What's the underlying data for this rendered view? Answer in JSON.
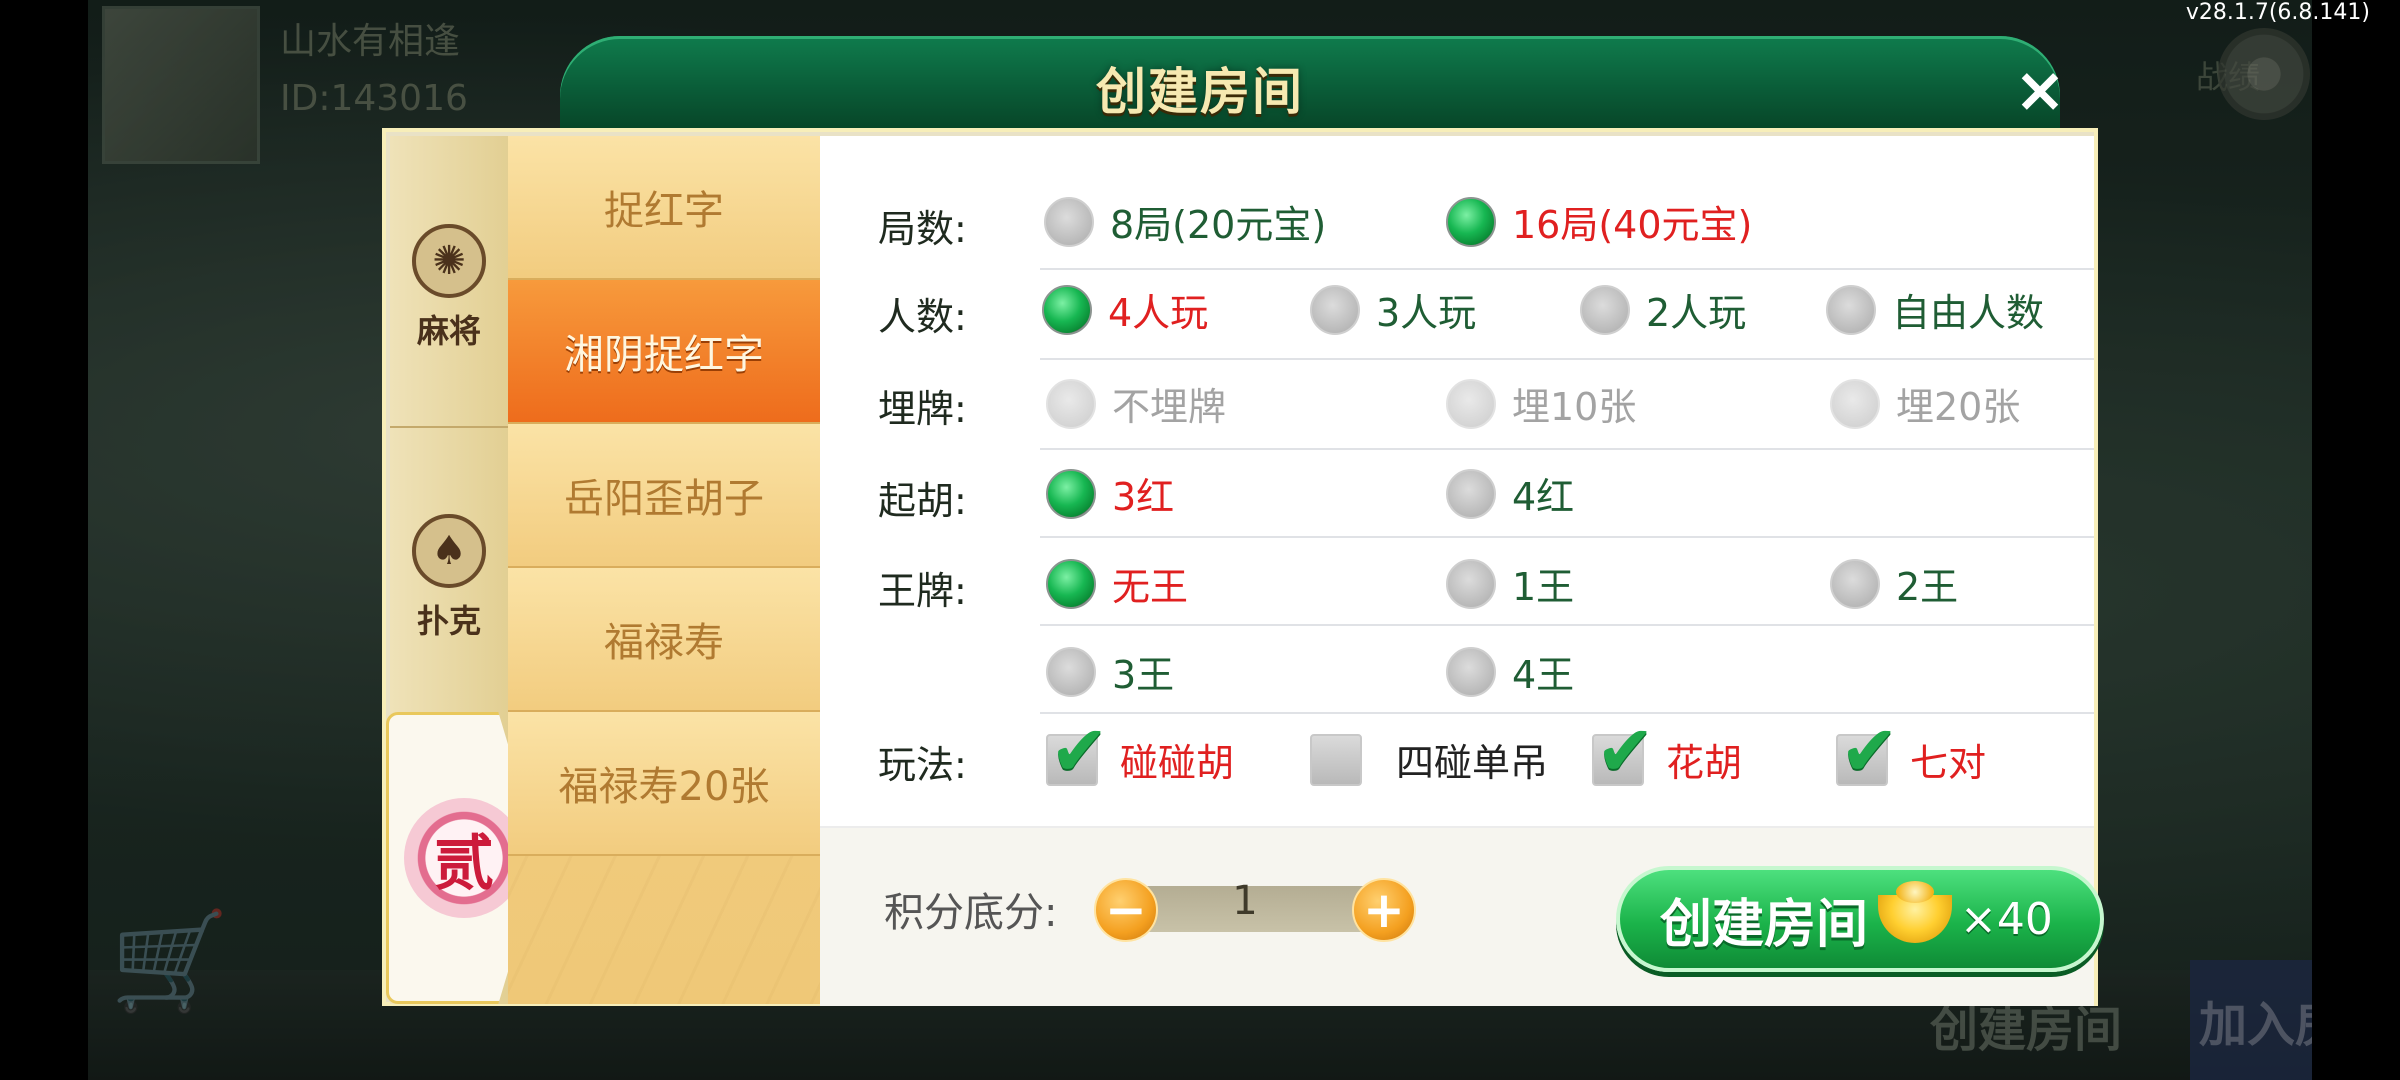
{
  "version": "v28.1.7(6.8.141)",
  "background": {
    "player_name": "山水有相逢",
    "player_id": "ID:143016",
    "record_label": "战绩",
    "bottom_create": "创建房间",
    "bottom_join": "加入房间"
  },
  "dialog": {
    "title": "创建房间",
    "close_label": "×"
  },
  "sidebar": {
    "categories": [
      {
        "label": "麻将",
        "icon": "mahjong-icon"
      },
      {
        "label": "扑克",
        "icon": "spade-icon"
      },
      {
        "label": "贰",
        "icon": "er-badge-icon"
      }
    ]
  },
  "games": [
    {
      "label": "捉红字",
      "active": false
    },
    {
      "label": "湘阴捉红字",
      "active": true
    },
    {
      "label": "岳阳歪胡子",
      "active": false
    },
    {
      "label": "福禄寿",
      "active": false
    },
    {
      "label": "福禄寿20张",
      "active": false
    }
  ],
  "options": {
    "rounds": {
      "label": "局数:",
      "choices": [
        "8局(20元宝)",
        "16局(40元宝)"
      ],
      "selected": 1
    },
    "players": {
      "label": "人数:",
      "choices": [
        "4人玩",
        "3人玩",
        "2人玩",
        "自由人数"
      ],
      "selected": 0
    },
    "bury": {
      "label": "埋牌:",
      "choices": [
        "不埋牌",
        "埋10张",
        "埋20张"
      ],
      "disabled": true
    },
    "qihu": {
      "label": "起胡:",
      "choices": [
        "3红",
        "4红"
      ],
      "selected": 0
    },
    "king": {
      "label": "王牌:",
      "choices": [
        "无王",
        "1王",
        "2王",
        "3王",
        "4王"
      ],
      "selected": 0
    },
    "play": {
      "label": "玩法:",
      "choices": [
        "碰碰胡",
        "四碰单吊",
        "花胡",
        "七对"
      ],
      "checked": [
        true,
        false,
        true,
        true
      ]
    }
  },
  "footer": {
    "score_label": "积分底分:",
    "score_value": "1",
    "minus": "−",
    "plus": "+",
    "create_label": "创建房间",
    "create_cost": "×40"
  },
  "colors": {
    "header_green": "#0a5b37",
    "active_tab_orange": "#ee6c1c",
    "selected_red": "#e02020",
    "create_green": "#1bb34a"
  }
}
